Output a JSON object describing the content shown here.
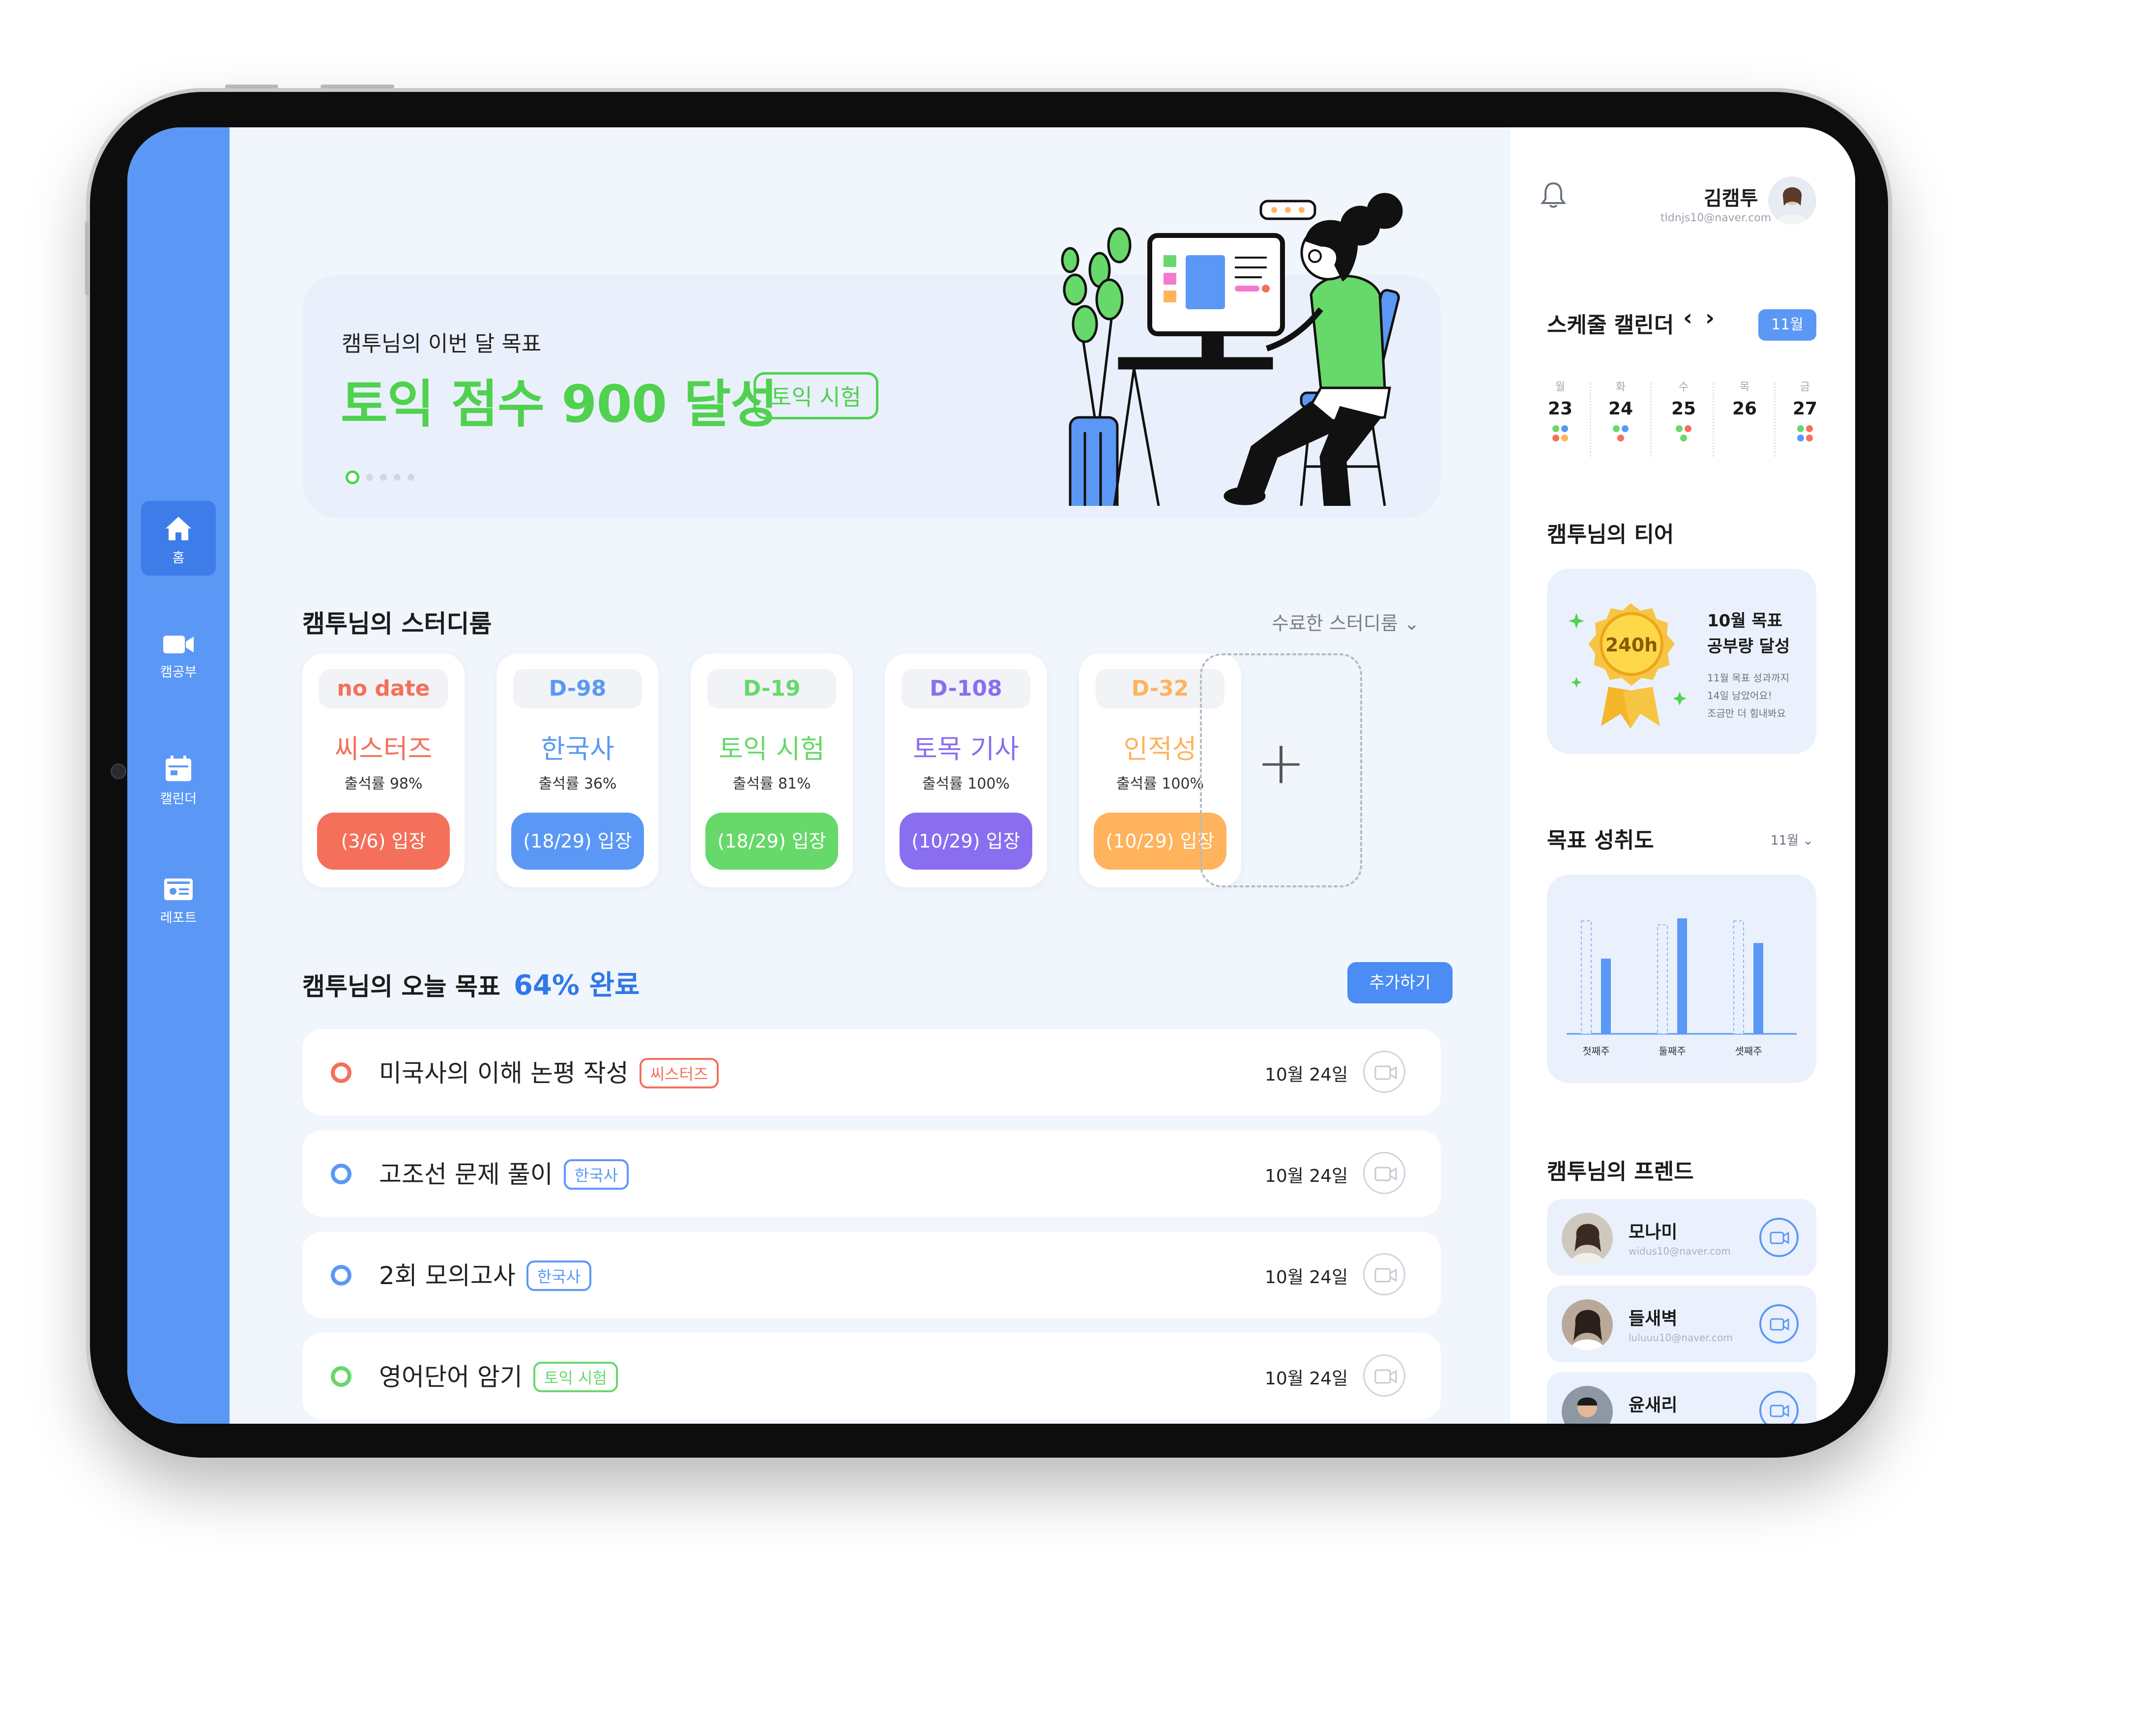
{
  "sidebar": {
    "items": [
      {
        "label": "홈",
        "icon": "home-icon",
        "active": true
      },
      {
        "label": "캠공부",
        "icon": "video-camera-icon",
        "active": false
      },
      {
        "label": "캘린더",
        "icon": "calendar-icon",
        "active": false
      },
      {
        "label": "레포트",
        "icon": "report-icon",
        "active": false
      }
    ]
  },
  "hero": {
    "subtitle": "캠투님의 이번 달 목표",
    "goal": "토익 점수 900 달성",
    "tag": "토익 시험",
    "slide_index": 1,
    "slide_count": 5
  },
  "studyrooms": {
    "title": "캠투님의 스터디룸",
    "completed_link": "수료한 스터디룸",
    "add_label": "+",
    "cards": [
      {
        "dday": "no date",
        "name": "씨스터즈",
        "rate": "출석률 98%",
        "button": "(3/6) 입장",
        "color": "#f4705a"
      },
      {
        "dday": "D-98",
        "name": "한국사",
        "rate": "출석률 36%",
        "button": "(18/29) 입장",
        "color": "#5b98f5"
      },
      {
        "dday": "D-19",
        "name": "토익 시험",
        "rate": "출석률 81%",
        "button": "(18/29) 입장",
        "color": "#67d86a"
      },
      {
        "dday": "D-108",
        "name": "토목 기사",
        "rate": "출석률 100%",
        "button": "(10/29) 입장",
        "color": "#8a6ef0"
      },
      {
        "dday": "D-32",
        "name": "인적성",
        "rate": "출석률 100%",
        "button": "(10/29) 입장",
        "color": "#ffb35c"
      }
    ]
  },
  "today": {
    "title": "캠투님의 오늘 목표",
    "progress": "64% 완료",
    "add_button": "추가하기",
    "todos": [
      {
        "text": "미국사의 이해 논평 작성",
        "tag": "씨스터즈",
        "date": "10월 24일",
        "color": "#f4705a"
      },
      {
        "text": "고조선 문제 풀이",
        "tag": "한국사",
        "date": "10월 24일",
        "color": "#5b98f5"
      },
      {
        "text": "2회 모의고사",
        "tag": "한국사",
        "date": "10월 24일",
        "color": "#5b98f5"
      },
      {
        "text": "영어단어 암기",
        "tag": "토익 시험",
        "date": "10월 24일",
        "color": "#67d86a"
      }
    ]
  },
  "user": {
    "name": "김캠투",
    "email": "tldnjs10@naver.com"
  },
  "calendar": {
    "title": "스케줄 캘린더",
    "prev": "‹",
    "next": "›",
    "month": "11월",
    "days": [
      {
        "dow": "월",
        "num": "23",
        "dots": [
          "#67d86a",
          "#5b98f5",
          "#f4705a",
          "#ffb35c"
        ]
      },
      {
        "dow": "화",
        "num": "24",
        "dots": [
          "#67d86a",
          "#5b98f5",
          "#f4705a"
        ]
      },
      {
        "dow": "수",
        "num": "25",
        "dots": [
          "#67d86a",
          "#f4705a",
          "#67d86a"
        ]
      },
      {
        "dow": "목",
        "num": "26",
        "dots": []
      },
      {
        "dow": "금",
        "num": "27",
        "dots": [
          "#67d86a",
          "#f4705a",
          "#5b98f5",
          "#f4705a"
        ]
      }
    ]
  },
  "tier": {
    "title": "캠투님의 티어",
    "badge": "240h",
    "line1": "10월 목표",
    "line2": "공부량 달성",
    "desc1": "11월 목표 성과까지",
    "desc2": "14일 남았어요!",
    "desc3": "조금만 더 힘내봐요"
  },
  "achievement": {
    "title": "목표 성취도",
    "month_select": "11월",
    "chart_data": {
      "type": "bar",
      "categories": [
        "첫째주",
        "둘째주",
        "셋째주"
      ],
      "series": [
        {
          "values": [
            87,
            84,
            87
          ]
        },
        {
          "values": [
            58,
            89,
            70
          ]
        }
      ],
      "ylim": [
        0,
        100
      ],
      "grid": false
    }
  },
  "friends": {
    "title": "캠투님의 프렌드",
    "list": [
      {
        "name": "모나미",
        "email": "widus10@naver.com"
      },
      {
        "name": "들새벽",
        "email": "luluuu10@naver.com"
      },
      {
        "name": "윤새리",
        "email": ""
      }
    ]
  },
  "colors": {
    "accent_blue": "#5b98f5",
    "green": "#50d14f",
    "coral": "#f4705a",
    "purple": "#8a6ef0",
    "orange": "#ffb35c"
  }
}
